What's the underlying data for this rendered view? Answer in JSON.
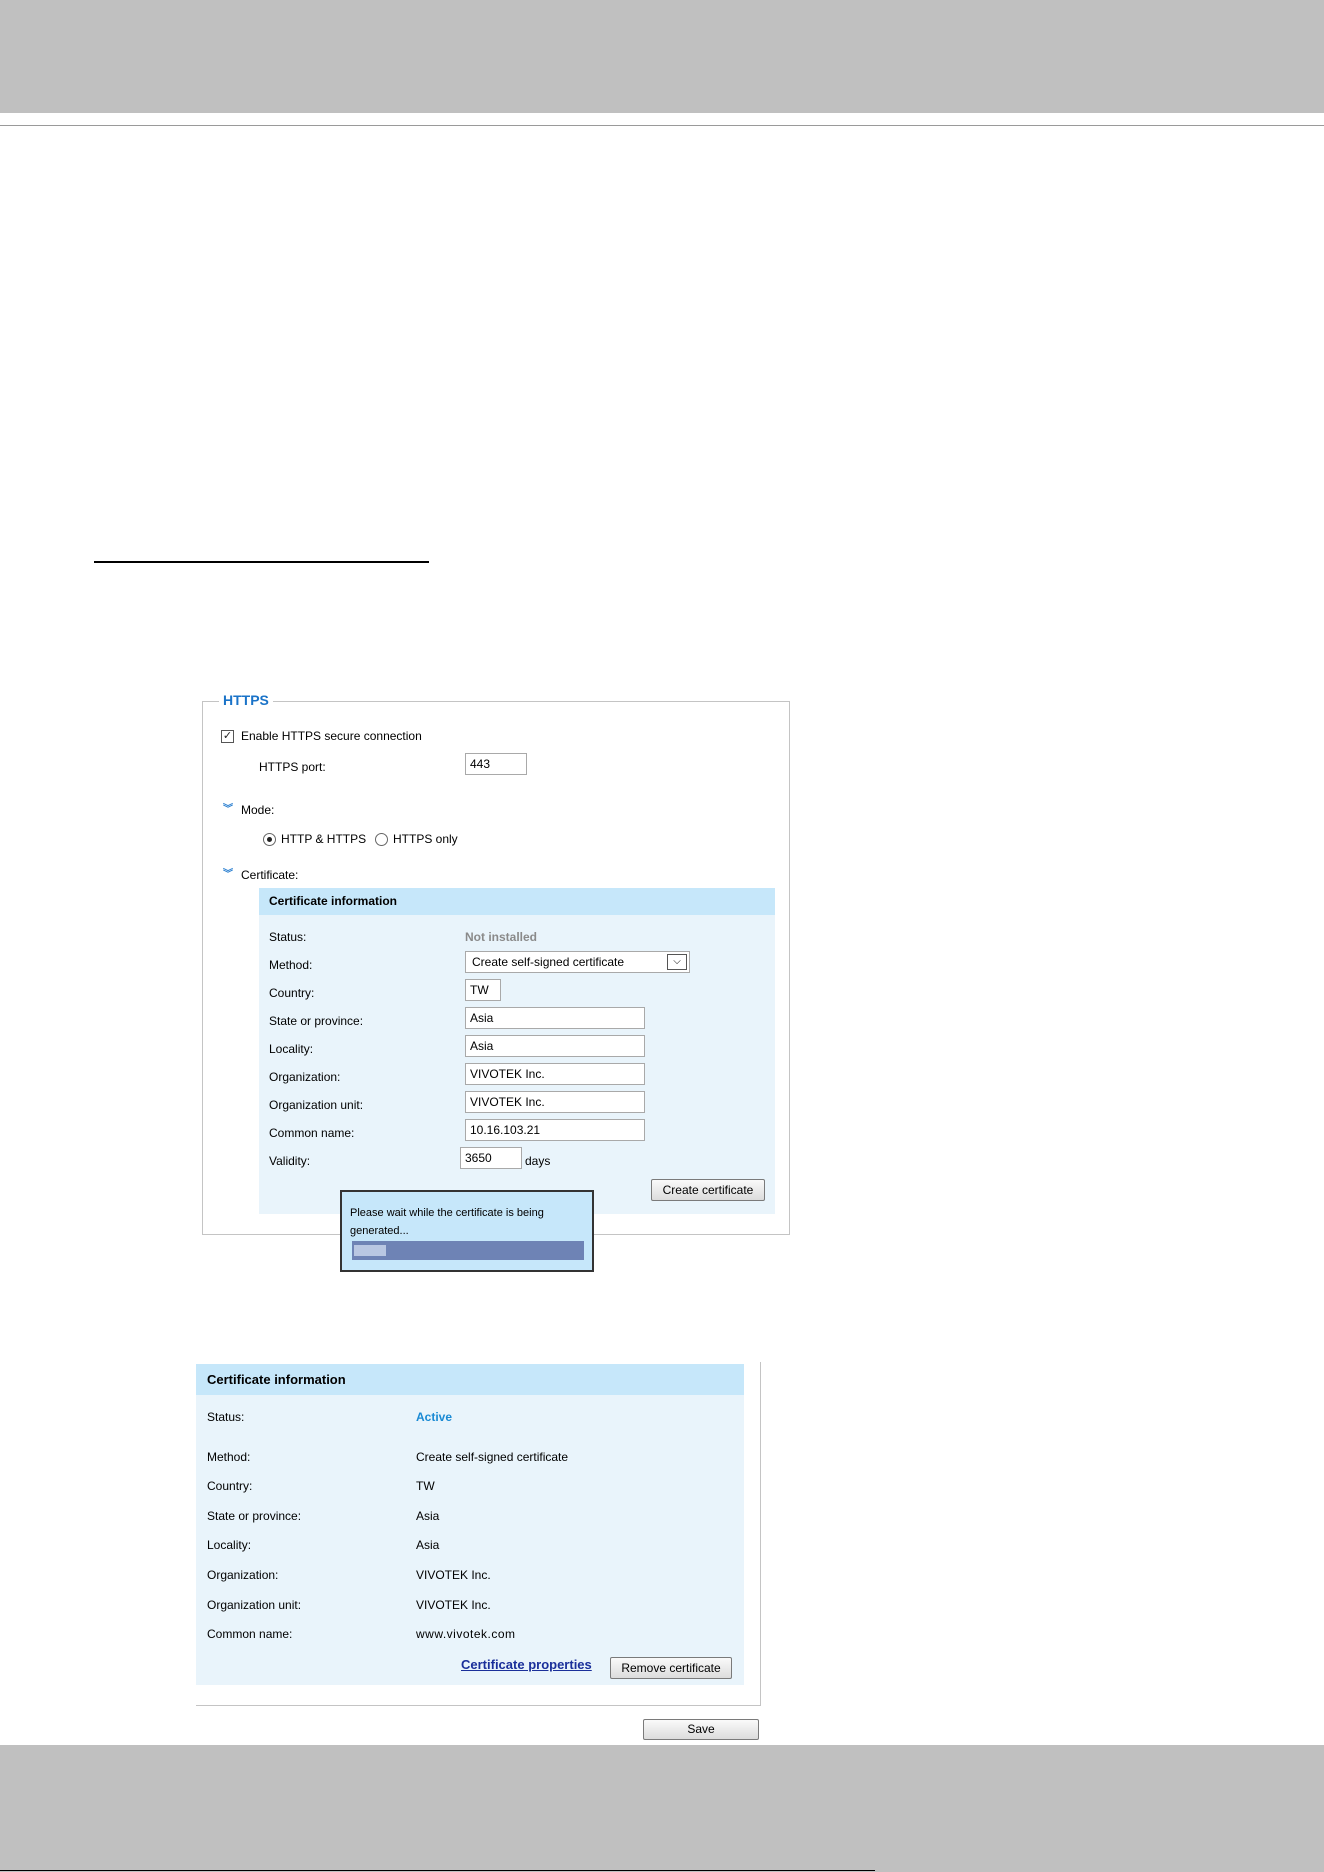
{
  "https": {
    "legend": "HTTPS",
    "enable_label": "Enable HTTPS secure connection",
    "enable_checked": true,
    "port_label": "HTTPS port:",
    "port_value": "443",
    "mode_label": "Mode:",
    "mode_options": [
      "HTTP & HTTPS",
      "HTTPS only"
    ],
    "mode_selected": "HTTP & HTTPS",
    "certificate_label": "Certificate:"
  },
  "cert_form": {
    "header": "Certificate information",
    "status_label": "Status:",
    "status_value": "Not installed",
    "method_label": "Method:",
    "method_value": "Create self-signed certificate",
    "country_label": "Country:",
    "country_value": "TW",
    "state_label": "State or province:",
    "state_value": "Asia",
    "locality_label": "Locality:",
    "locality_value": "Asia",
    "org_label": "Organization:",
    "org_value": "VIVOTEK Inc.",
    "org_unit_label": "Organization unit:",
    "org_unit_value": "VIVOTEK Inc.",
    "common_name_label": "Common name:",
    "common_name_value": "10.16.103.21",
    "validity_label": "Validity:",
    "validity_value": "3650",
    "validity_unit": "days",
    "create_button": "Create certificate"
  },
  "wait_popup": {
    "message": "Please wait while the certificate is being generated...",
    "progress_fraction": 0.14
  },
  "cert_info": {
    "header": "Certificate information",
    "status_label": "Status:",
    "status_value": "Active",
    "method_label": "Method:",
    "method_value": "Create self-signed certificate",
    "country_label": "Country:",
    "country_value": "TW",
    "state_label": "State or province:",
    "state_value": "Asia",
    "locality_label": "Locality:",
    "locality_value": "Asia",
    "org_label": "Organization:",
    "org_value": "VIVOTEK Inc.",
    "org_unit_label": "Organization unit:",
    "org_unit_value": "VIVOTEK Inc.",
    "common_name_label": "Common name:",
    "common_name_value": "www.vivotek.com",
    "properties_link": "Certificate properties",
    "remove_button": "Remove certificate"
  },
  "footer": {
    "save_button": "Save"
  },
  "colors": {
    "accent_blue": "#1a73c8",
    "active_status": "#1a8ad4",
    "panel_header": "#c6e7fa",
    "panel_body": "#e9f4fb",
    "page_band": "#c0c0c0"
  }
}
